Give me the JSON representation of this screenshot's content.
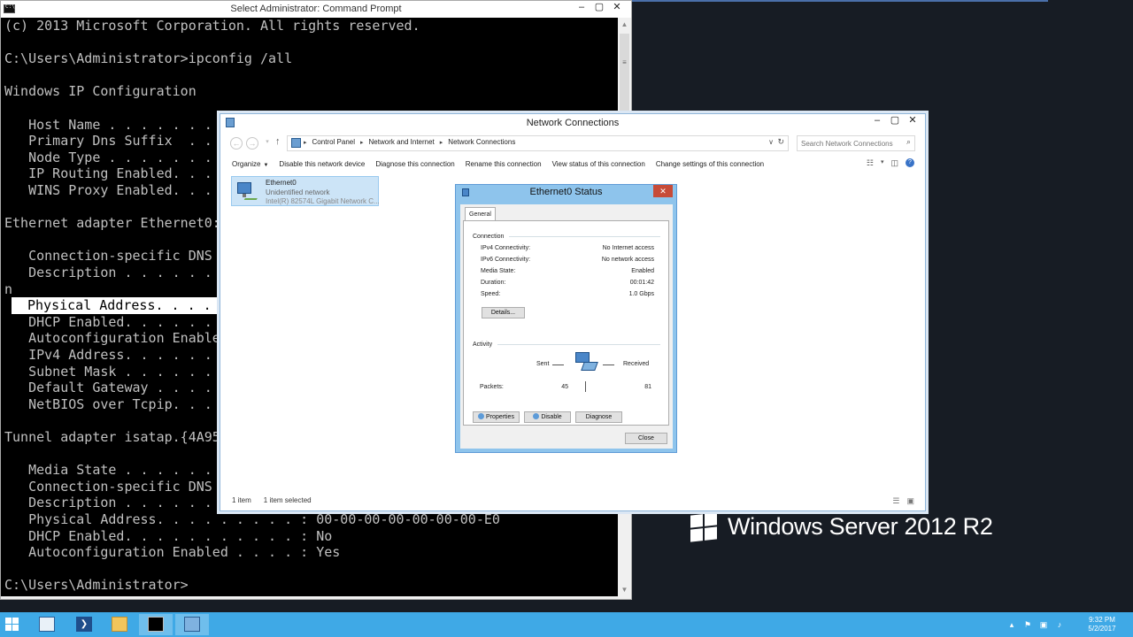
{
  "brand": {
    "text": "Windows Server 2012 R2"
  },
  "cmd": {
    "title": "Select Administrator: Command Prompt",
    "lines": [
      "(c) 2013 Microsoft Corporation. All rights reserved.",
      "",
      "C:\\Users\\Administrator>ipconfig /all",
      "",
      "Windows IP Configuration",
      "",
      "   Host Name . . . . . . .",
      "   Primary Dns Suffix  . . .",
      "   Node Type . . . . . . . .",
      "   IP Routing Enabled. . . .",
      "   WINS Proxy Enabled. . . .",
      "",
      "Ethernet adapter Ethernet0:",
      "",
      "   Connection-specific DNS S",
      "   Description . . . . . . .",
      "n",
      "Physical Address. . . . .",
      "   DHCP Enabled. . . . . . .",
      "   Autoconfiguration Enabled",
      "   IPv4 Address. . . . . . .",
      "   Subnet Mask . . . . . . .",
      "   Default Gateway . . . . .",
      "   NetBIOS over Tcpip. . . .",
      "",
      "Tunnel adapter isatap.{4A95F",
      "",
      "   Media State . . . . . . .",
      "   Connection-specific DNS S",
      "   Description . . . . . . .",
      "   Physical Address. . . . . . . . . : 00-00-00-00-00-00-00-E0",
      "   DHCP Enabled. . . . . . . . . . . : No",
      "   Autoconfiguration Enabled . . . . : Yes",
      "",
      "C:\\Users\\Administrator>"
    ]
  },
  "net": {
    "title": "Network Connections",
    "breadcrumb": [
      "Control Panel",
      "Network and Internet",
      "Network Connections"
    ],
    "search_placeholder": "Search Network Connections",
    "commands": {
      "organize": "Organize",
      "disable": "Disable this network device",
      "diagnose": "Diagnose this connection",
      "rename": "Rename this connection",
      "view_status": "View status of this connection",
      "change_settings": "Change settings of this connection"
    },
    "item": {
      "name": "Ethernet0",
      "status": "Unidentified network",
      "adapter": "Intel(R) 82574L Gigabit Network C..."
    },
    "status": {
      "count": "1 item",
      "selected": "1 item selected"
    }
  },
  "dialog": {
    "title": "Ethernet0 Status",
    "tab": "General",
    "connection_header": "Connection",
    "rows": [
      {
        "label": "IPv4 Connectivity:",
        "value": "No Internet access"
      },
      {
        "label": "IPv6 Connectivity:",
        "value": "No network access"
      },
      {
        "label": "Media State:",
        "value": "Enabled"
      },
      {
        "label": "Duration:",
        "value": "00:01:42"
      },
      {
        "label": "Speed:",
        "value": "1.0 Gbps"
      }
    ],
    "details_button": "Details...",
    "activity_header": "Activity",
    "sent_label": "Sent",
    "received_label": "Received",
    "packets_label": "Packets:",
    "packets_sent": "45",
    "packets_received": "81",
    "properties_button": "Properties",
    "disable_button": "Disable",
    "diagnose_button": "Diagnose",
    "close_button": "Close"
  },
  "taskbar": {
    "time": "9:32 PM",
    "date": "5/2/2017"
  }
}
